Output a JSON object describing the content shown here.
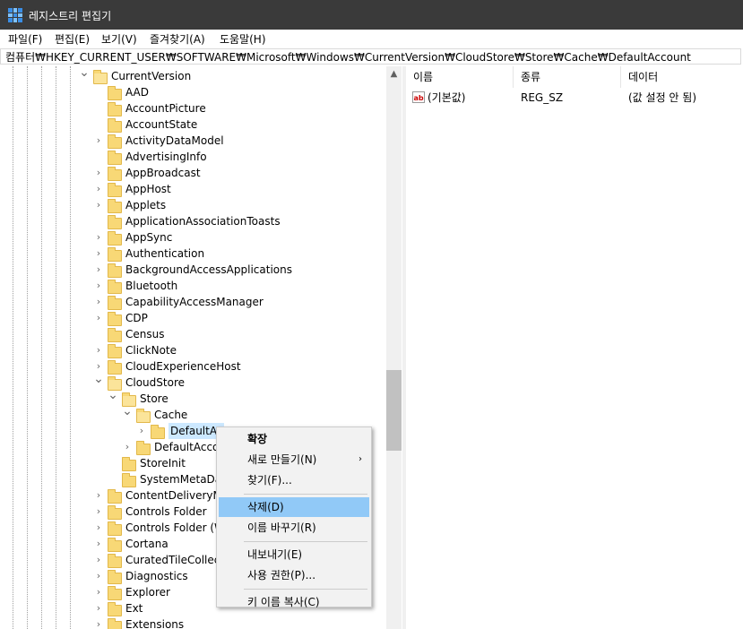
{
  "window": {
    "title": "레지스트리 편집기"
  },
  "menu": [
    "파일(F)",
    "편집(E)",
    "보기(V)",
    "즐겨찾기(A)",
    "도움말(H)"
  ],
  "address": "컴퓨터₩HKEY_CURRENT_USER₩SOFTWARE₩Microsoft₩Windows₩CurrentVersion₩CloudStore₩Store₩Cache₩DefaultAccount",
  "tree": [
    {
      "label": "CurrentVersion",
      "level": 0,
      "chevron": "expanded"
    },
    {
      "label": "AAD",
      "level": 1,
      "chevron": "none"
    },
    {
      "label": "AccountPicture",
      "level": 1,
      "chevron": "none"
    },
    {
      "label": "AccountState",
      "level": 1,
      "chevron": "none"
    },
    {
      "label": "ActivityDataModel",
      "level": 1,
      "chevron": "collapsed"
    },
    {
      "label": "AdvertisingInfo",
      "level": 1,
      "chevron": "none"
    },
    {
      "label": "AppBroadcast",
      "level": 1,
      "chevron": "collapsed"
    },
    {
      "label": "AppHost",
      "level": 1,
      "chevron": "collapsed"
    },
    {
      "label": "Applets",
      "level": 1,
      "chevron": "collapsed"
    },
    {
      "label": "ApplicationAssociationToasts",
      "level": 1,
      "chevron": "none"
    },
    {
      "label": "AppSync",
      "level": 1,
      "chevron": "collapsed"
    },
    {
      "label": "Authentication",
      "level": 1,
      "chevron": "collapsed"
    },
    {
      "label": "BackgroundAccessApplications",
      "level": 1,
      "chevron": "collapsed"
    },
    {
      "label": "Bluetooth",
      "level": 1,
      "chevron": "collapsed"
    },
    {
      "label": "CapabilityAccessManager",
      "level": 1,
      "chevron": "collapsed"
    },
    {
      "label": "CDP",
      "level": 1,
      "chevron": "collapsed"
    },
    {
      "label": "Census",
      "level": 1,
      "chevron": "none"
    },
    {
      "label": "ClickNote",
      "level": 1,
      "chevron": "collapsed"
    },
    {
      "label": "CloudExperienceHost",
      "level": 1,
      "chevron": "collapsed"
    },
    {
      "label": "CloudStore",
      "level": 1,
      "chevron": "expanded"
    },
    {
      "label": "Store",
      "level": 2,
      "chevron": "expanded"
    },
    {
      "label": "Cache",
      "level": 3,
      "chevron": "expanded"
    },
    {
      "label": "DefaultAc",
      "level": 4,
      "chevron": "collapsed",
      "selected": true
    },
    {
      "label": "DefaultAccou",
      "level": 3,
      "chevron": "collapsed"
    },
    {
      "label": "StoreInit",
      "level": 2,
      "chevron": "none"
    },
    {
      "label": "SystemMetaDat",
      "level": 2,
      "chevron": "none"
    },
    {
      "label": "ContentDeliveryMa",
      "level": 1,
      "chevron": "collapsed"
    },
    {
      "label": "Controls Folder",
      "level": 1,
      "chevron": "collapsed"
    },
    {
      "label": "Controls Folder (W",
      "level": 1,
      "chevron": "collapsed"
    },
    {
      "label": "Cortana",
      "level": 1,
      "chevron": "collapsed"
    },
    {
      "label": "CuratedTileCollecti",
      "level": 1,
      "chevron": "collapsed"
    },
    {
      "label": "Diagnostics",
      "level": 1,
      "chevron": "collapsed"
    },
    {
      "label": "Explorer",
      "level": 1,
      "chevron": "collapsed"
    },
    {
      "label": "Ext",
      "level": 1,
      "chevron": "collapsed"
    },
    {
      "label": "Extensions",
      "level": 1,
      "chevron": "collapsed"
    }
  ],
  "list": {
    "columns": [
      "이름",
      "종류",
      "데이터"
    ],
    "rows": [
      {
        "icon": "string-value-icon",
        "icon_text": "ab",
        "name": "(기본값)",
        "type": "REG_SZ",
        "data": "(값 설정 안 됨)"
      }
    ]
  },
  "context_menu": [
    {
      "label": "확장",
      "bold": true
    },
    {
      "label": "새로 만들기(N)",
      "submenu": true
    },
    {
      "label": "찾기(F)..."
    },
    {
      "separator": true
    },
    {
      "label": "삭제(D)",
      "highlighted": true
    },
    {
      "label": "이름 바꾸기(R)"
    },
    {
      "separator": true
    },
    {
      "label": "내보내기(E)"
    },
    {
      "label": "사용 권한(P)..."
    },
    {
      "separator": true
    },
    {
      "label": "키 이름 복사(C)"
    }
  ],
  "colors": {
    "titlebar": "#3a3a3a",
    "folder": "#f8d876",
    "menu_highlight": "#91c9f7",
    "selection": "#cce8ff"
  }
}
